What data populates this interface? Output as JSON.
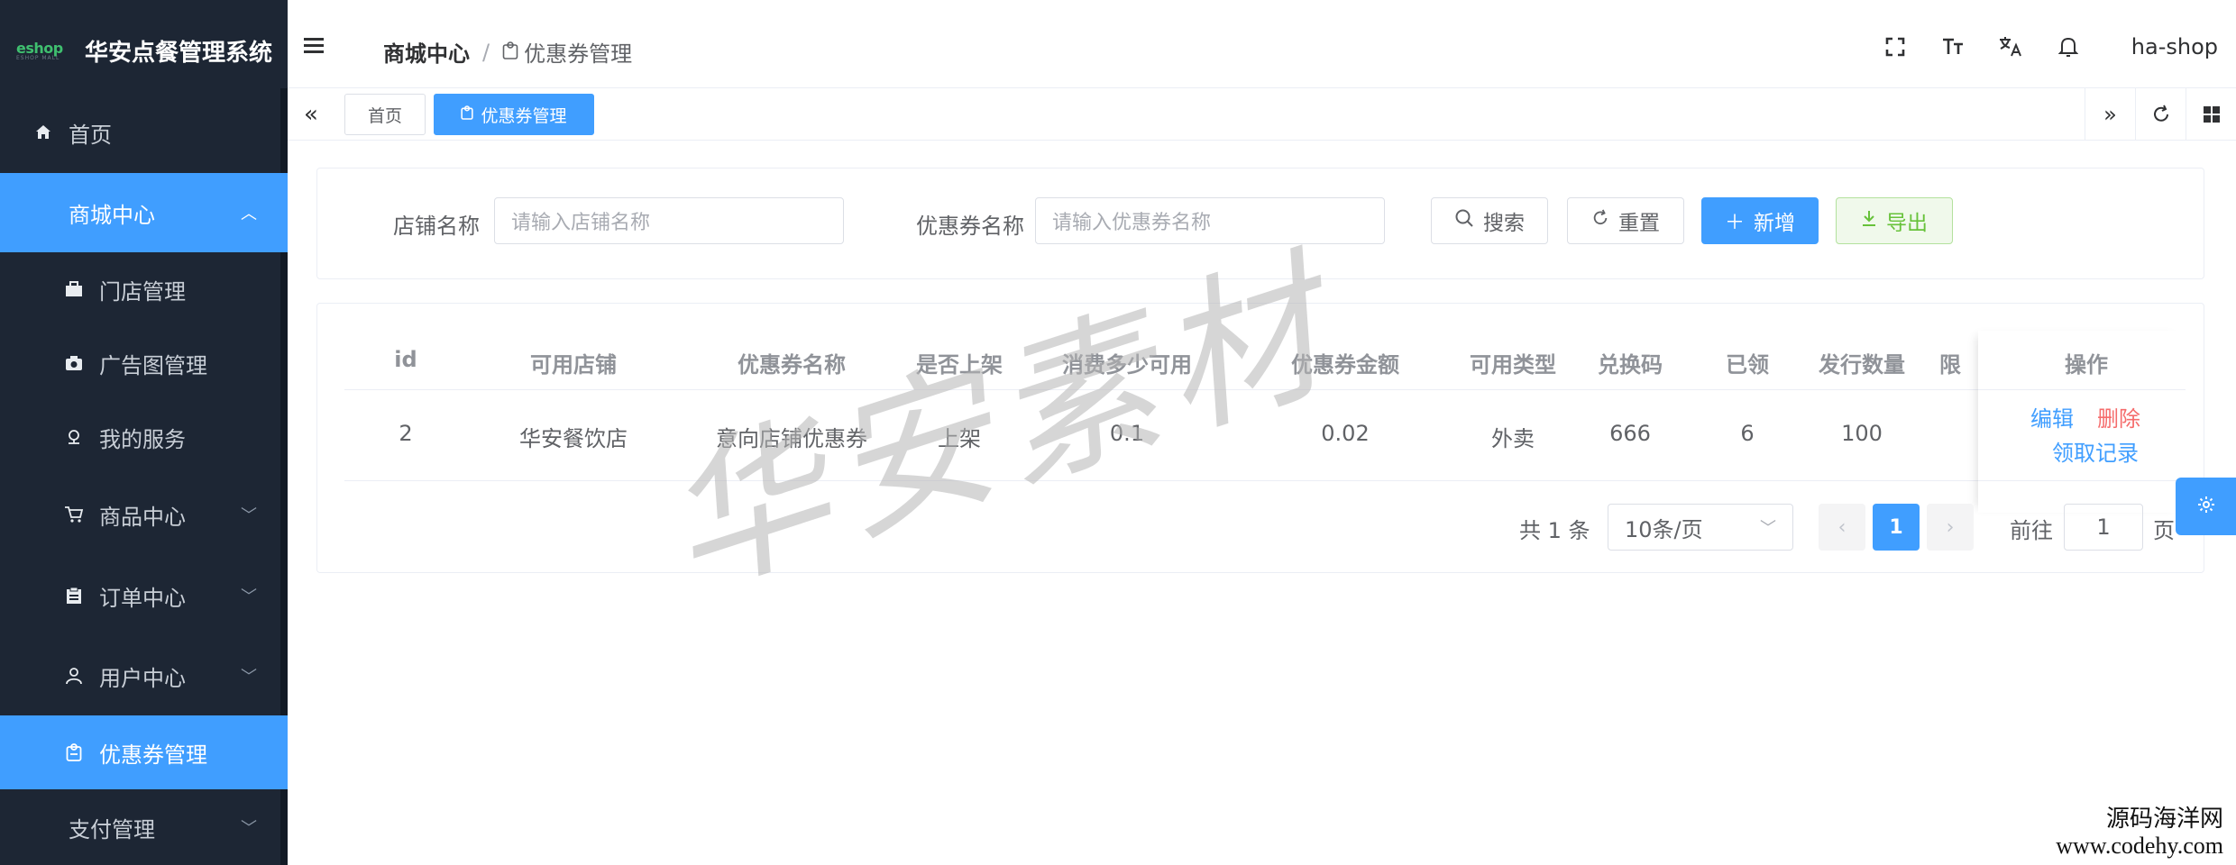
{
  "brand": {
    "logo": "eshop",
    "title": "华安点餐管理系统"
  },
  "sidebar": {
    "items": [
      {
        "label": "首页",
        "icon": "home-icon"
      },
      {
        "label": "商城中心",
        "icon": "",
        "expanded": true
      },
      {
        "label": "门店管理",
        "icon": "briefcase-icon"
      },
      {
        "label": "广告图管理",
        "icon": "camera-icon"
      },
      {
        "label": "我的服务",
        "icon": "service-icon"
      },
      {
        "label": "商品中心",
        "icon": "cart-icon"
      },
      {
        "label": "订单中心",
        "icon": "clipboard-icon"
      },
      {
        "label": "用户中心",
        "icon": "user-icon"
      },
      {
        "label": "优惠券管理",
        "icon": "coupon-icon"
      },
      {
        "label": "支付管理",
        "icon": ""
      }
    ]
  },
  "header": {
    "breadcrumb": [
      "商城中心",
      "优惠券管理"
    ],
    "username": "ha-shop"
  },
  "tabs": [
    {
      "label": "首页"
    },
    {
      "label": "优惠券管理"
    }
  ],
  "search": {
    "shop_label": "店铺名称",
    "shop_placeholder": "请输入店铺名称",
    "coupon_label": "优惠券名称",
    "coupon_placeholder": "请输入优惠券名称",
    "btn_search": "搜索",
    "btn_reset": "重置",
    "btn_add": "新增",
    "btn_export": "导出"
  },
  "table": {
    "columns": [
      "id",
      "可用店铺",
      "优惠券名称",
      "是否上架",
      "消费多少可用",
      "优惠券金额",
      "可用类型",
      "兑换码",
      "已领",
      "发行数量",
      "限",
      "操作"
    ],
    "rows": [
      [
        "2",
        "华安餐饮店",
        "意向店铺优惠券",
        "上架",
        "0.1",
        "0.02",
        "外卖",
        "666",
        "6",
        "100"
      ]
    ],
    "actions": {
      "edit": "编辑",
      "delete": "删除",
      "records": "领取记录"
    }
  },
  "pagination": {
    "total": "共 1 条",
    "page_size": "10条/页",
    "current": "1",
    "goto_label": "前往",
    "goto_value": "1",
    "page_suffix": "页"
  },
  "watermark": {
    "text": "华安素材",
    "corner1": "源码海洋网",
    "corner2": "www.codehy.com"
  },
  "colors": {
    "primary": "#409eff",
    "sidebar_bg": "#1d2634",
    "danger": "#f56c6c",
    "success": "#67c23a"
  }
}
